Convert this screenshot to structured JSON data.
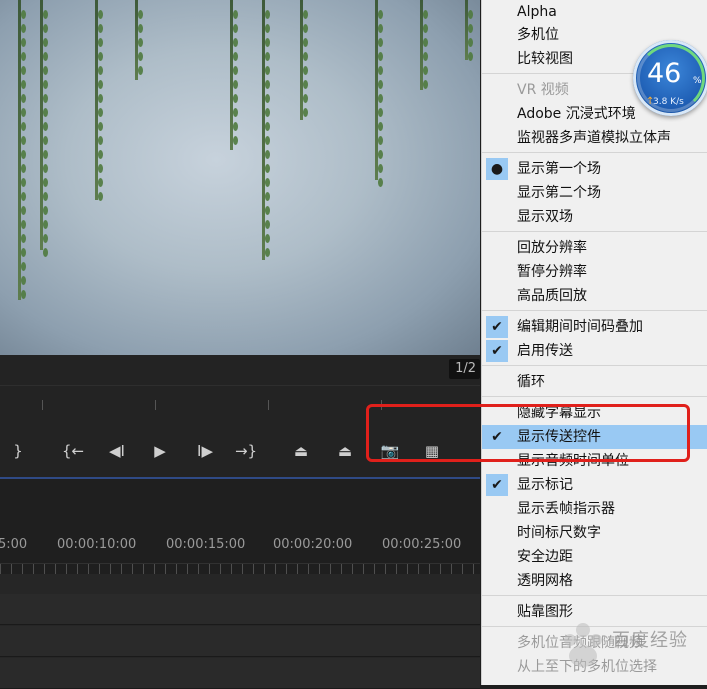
{
  "monitor": {
    "page_indicator": "1/2"
  },
  "transport": {
    "buttons": [
      {
        "name": "mark-out-button",
        "glyph": "}"
      },
      {
        "name": "go-to-in-button",
        "glyph": "{←"
      },
      {
        "name": "step-back-button",
        "glyph": "◀I"
      },
      {
        "name": "play-button",
        "glyph": "▶"
      },
      {
        "name": "step-forward-button",
        "glyph": "I▶"
      },
      {
        "name": "go-to-out-button",
        "glyph": "→}"
      },
      {
        "name": "lift-button",
        "glyph": "⏏"
      },
      {
        "name": "extract-button",
        "glyph": "⏏"
      },
      {
        "name": "export-frame-button",
        "glyph": "📷"
      },
      {
        "name": "button-editor-button",
        "glyph": "▦"
      }
    ]
  },
  "timeline": {
    "timecodes": [
      "5:00",
      "00:00:10:00",
      "00:00:15:00",
      "00:00:20:00",
      "00:00:25:00"
    ]
  },
  "menu": {
    "items": [
      {
        "label": "Alpha",
        "state": "normal"
      },
      {
        "label": "多机位",
        "state": "normal"
      },
      {
        "label": "比较视图",
        "state": "normal"
      },
      {
        "label": "VR 视频",
        "state": "disabled"
      },
      {
        "label": "Adobe 沉浸式环境",
        "state": "normal"
      },
      {
        "label": "监视器多声道模拟立体声",
        "state": "normal"
      },
      {
        "label": "显示第一个场",
        "state": "normal",
        "mark": "●"
      },
      {
        "label": "显示第二个场",
        "state": "normal"
      },
      {
        "label": "显示双场",
        "state": "normal"
      },
      {
        "label": "回放分辨率",
        "state": "normal"
      },
      {
        "label": "暂停分辨率",
        "state": "normal"
      },
      {
        "label": "高品质回放",
        "state": "normal"
      },
      {
        "label": "编辑期间时间码叠加",
        "state": "normal",
        "mark": "✔"
      },
      {
        "label": "启用传送",
        "state": "normal",
        "mark": "✔"
      },
      {
        "label": "循环",
        "state": "normal"
      },
      {
        "label": "隐藏字幕显示",
        "state": "normal"
      },
      {
        "label": "显示传送控件",
        "state": "highlight",
        "mark": "✔"
      },
      {
        "label": "显示音频时间单位",
        "state": "normal"
      },
      {
        "label": "显示标记",
        "state": "normal",
        "mark": "✔"
      },
      {
        "label": "显示丢帧指示器",
        "state": "normal"
      },
      {
        "label": "时间标尺数字",
        "state": "normal"
      },
      {
        "label": "安全边距",
        "state": "normal"
      },
      {
        "label": "透明网格",
        "state": "normal"
      },
      {
        "label": "贴靠图形",
        "state": "normal"
      },
      {
        "label": "多机位音频跟随视频",
        "state": "disabled"
      },
      {
        "label": "从上至下的多机位选择",
        "state": "disabled"
      }
    ]
  },
  "speed_widget": {
    "percent": "46",
    "percent_unit": "%",
    "rate": "3.8 K/s",
    "arrow_color": "#ffb02e"
  },
  "watermark": {
    "text": "百度经验"
  },
  "colors": {
    "highlight": "#99c9f3",
    "annotation": "#e0201b",
    "menu_bg": "#f0f0f0"
  }
}
